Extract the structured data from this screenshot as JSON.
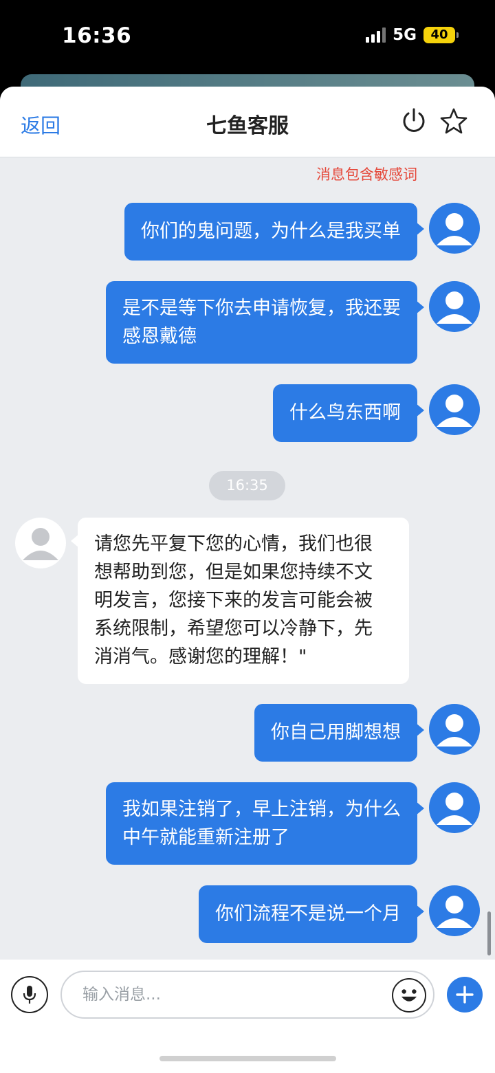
{
  "status_bar": {
    "time": "16:36",
    "network": "5G",
    "battery": "40"
  },
  "header": {
    "back_label": "返回",
    "title": "七鱼客服"
  },
  "notice": {
    "sensitive_word_warning": "消息包含敏感词"
  },
  "timestamp_divider": "16:35",
  "messages": [
    {
      "sender": "user",
      "text": "你们的鬼问题，为什么是我买单"
    },
    {
      "sender": "user",
      "text": "是不是等下你去申请恢复，我还要\n感恩戴德"
    },
    {
      "sender": "user",
      "text": "什么鸟东西啊"
    },
    {
      "sender": "agent",
      "text": "请您先平复下您的心情，我们也很\n想帮助到您，但是如果您持续不文\n明发言，您接下来的发言可能会被\n系统限制，希望您可以冷静下，先\n消消气。感谢您的理解！\""
    },
    {
      "sender": "user",
      "text": "你自己用脚想想"
    },
    {
      "sender": "user",
      "text": "我如果注销了，早上注销，为什么\n中午就能重新注册了"
    },
    {
      "sender": "user",
      "text": "你们流程不是说一个月"
    }
  ],
  "input_bar": {
    "placeholder": "输入消息..."
  },
  "colors": {
    "accent": "#2c7be5",
    "warning": "#e5483a",
    "background": "#ebedf0"
  },
  "icons": {
    "header_power": "power-icon",
    "header_favorite": "star-icon",
    "voice": "microphone-icon",
    "emoji": "emoji-icon",
    "more": "plus-icon"
  }
}
